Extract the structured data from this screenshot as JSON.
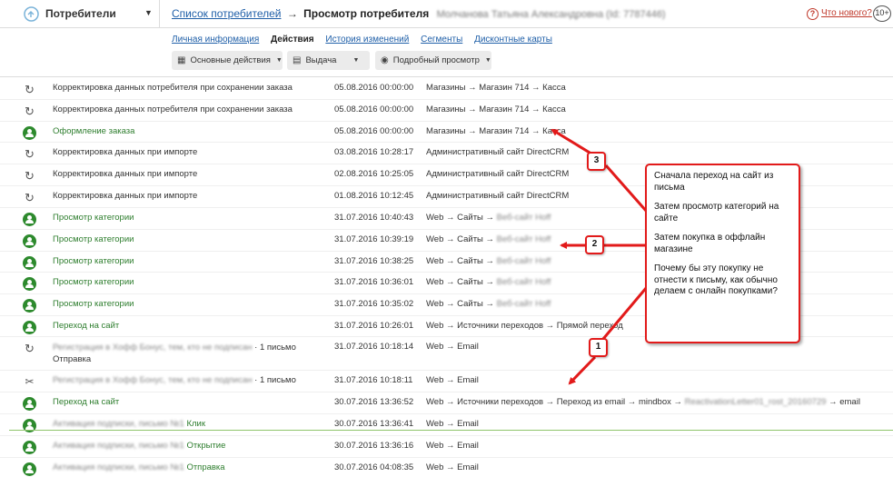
{
  "app": {
    "name": "Потребители"
  },
  "breadcrumb": {
    "link": "Список потребителей",
    "arrow": "→",
    "current": "Просмотр потребителя",
    "customer_blurred": "Молчанова Татьяна Александровна (Id: 7787446)"
  },
  "header_right": {
    "help_symbol": "?",
    "whats_new": "Что нового?",
    "badge": "10+"
  },
  "tabs": [
    {
      "label": "Личная информация"
    },
    {
      "label": "Действия"
    },
    {
      "label": "История изменений"
    },
    {
      "label": "Сегменты"
    },
    {
      "label": "Дисконтные карты"
    }
  ],
  "toolbar": {
    "main_actions": "Основные действия",
    "issue": "Выдача",
    "detailed_view": "Подробный просмотр"
  },
  "icons": {
    "user": "user-icon",
    "update": "recycle-icon",
    "tools": "tools-icon"
  },
  "rows": [
    {
      "icon": "recycle",
      "name": "Корректировка данных потребителя при сохранении заказа",
      "date": "05.08.2016 00:00:00",
      "path": "Магазины → Магазин 714 → Касса"
    },
    {
      "icon": "recycle",
      "name": "Корректировка данных потребителя при сохранении заказа",
      "date": "05.08.2016 00:00:00",
      "path": "Магазины → Магазин 714 → Касса"
    },
    {
      "icon": "user",
      "name": "Оформление заказа",
      "date": "05.08.2016 00:00:00",
      "path": "Магазины → Магазин 714 → Касса"
    },
    {
      "icon": "recycle",
      "name": "Корректировка данных при импорте",
      "date": "03.08.2016 10:28:17",
      "path": "Административный сайт DirectCRM"
    },
    {
      "icon": "recycle",
      "name": "Корректировка данных при импорте",
      "date": "02.08.2016 10:25:05",
      "path": "Административный сайт DirectCRM"
    },
    {
      "icon": "recycle",
      "name": "Корректировка данных при импорте",
      "date": "01.08.2016 10:12:45",
      "path": "Административный сайт DirectCRM"
    },
    {
      "icon": "user",
      "name": "Просмотр категории",
      "date": "31.07.2016 10:40:43",
      "path": "Web → Сайты →",
      "path_blur": "Веб-сайт Hoff"
    },
    {
      "icon": "user",
      "name": "Просмотр категории",
      "date": "31.07.2016 10:39:19",
      "path": "Web → Сайты →",
      "path_blur": "Веб-сайт Hoff"
    },
    {
      "icon": "user",
      "name": "Просмотр категории",
      "date": "31.07.2016 10:38:25",
      "path": "Web → Сайты →",
      "path_blur": "Веб-сайт Hoff"
    },
    {
      "icon": "user",
      "name": "Просмотр категории",
      "date": "31.07.2016 10:36:01",
      "path": "Web → Сайты →",
      "path_blur": "Веб-сайт Hoff"
    },
    {
      "icon": "user",
      "name": "Просмотр категории",
      "date": "31.07.2016 10:35:02",
      "path": "Web → Сайты →",
      "path_blur": "Веб-сайт Hoff"
    },
    {
      "icon": "user",
      "name": "Переход на сайт",
      "date": "31.07.2016 10:26:01",
      "path": "Web → Источники переходов → Прямой переход"
    },
    {
      "icon": "recycle",
      "name_blur": "Регистрация в Хофф Бонус, тем, кто не подписан",
      "name": "· 1 письмо",
      "name_line2": "Отправка",
      "date": "31.07.2016 10:18:14",
      "path": "Web → Email"
    },
    {
      "icon": "tools",
      "name_blur": "Регистрация в Хофф Бонус, тем, кто не подписан",
      "name": "· 1 письмо",
      "date": "31.07.2016 10:18:11",
      "path": "Web → Email"
    },
    {
      "icon": "user",
      "name": "Переход на сайт",
      "date": "30.07.2016 13:36:52",
      "path": "Web → Источники переходов → Переход из email → mindbox →",
      "path_blur": "ReactivationLetter01_rost_20160729",
      "path_tail": "→ email"
    },
    {
      "icon": "user",
      "name_blur": "Активация подписки, письмо №1",
      "name": "Клик",
      "date": "30.07.2016 13:36:41",
      "path": "Web → Email"
    },
    {
      "icon": "user",
      "name_blur": "Активация подписки, письмо №1",
      "name": "Открытие",
      "date": "30.07.2016 13:36:16",
      "path": "Web → Email"
    },
    {
      "icon": "user",
      "name_blur": "Активация подписки, письмо №1",
      "name": "Отправка",
      "date": "30.07.2016 04:08:35",
      "path": "Web → Email"
    }
  ],
  "annotation": {
    "callout": [
      "Сначала переход на сайт из письма",
      "Затем просмотр категорий на сайте",
      "Затем покупка в оффлайн магазине",
      "Почему бы эту покупку не отнести к письму, как обычно делаем с онлайн покупками?"
    ],
    "markers": [
      "3",
      "2",
      "1"
    ],
    "color": "#e21a1a"
  },
  "colors": {
    "link": "#1f5fa8",
    "green": "#2d7d2d",
    "accent_red": "#c0392b"
  }
}
